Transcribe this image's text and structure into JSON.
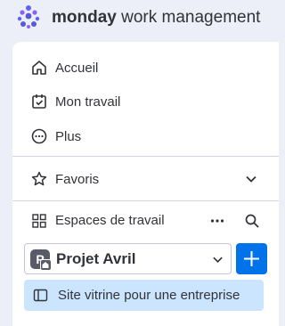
{
  "brand": {
    "name_bold": "monday",
    "name_rest": " work management"
  },
  "nav": {
    "home": "Accueil",
    "my_work": "Mon travail",
    "more": "Plus",
    "favorites": "Favoris"
  },
  "workspaces": {
    "header": "Espaces de travail",
    "current": {
      "initial": "P",
      "name": "Projet Avril"
    },
    "boards": [
      {
        "label": "Site vitrine pour une entreprise"
      }
    ]
  },
  "colors": {
    "background": "#eceff8",
    "primary": "#0073ea",
    "selected": "#cce5ff",
    "logo_dots": [
      "#6161ff",
      "#8b63f5",
      "#5559df"
    ]
  },
  "icons": [
    "monday-logo-icon",
    "home-icon",
    "calendar-check-icon",
    "more-circle-icon",
    "star-icon",
    "chevron-down-icon",
    "workspaces-grid-icon",
    "ellipsis-icon",
    "search-icon",
    "plus-icon",
    "board-icon"
  ]
}
